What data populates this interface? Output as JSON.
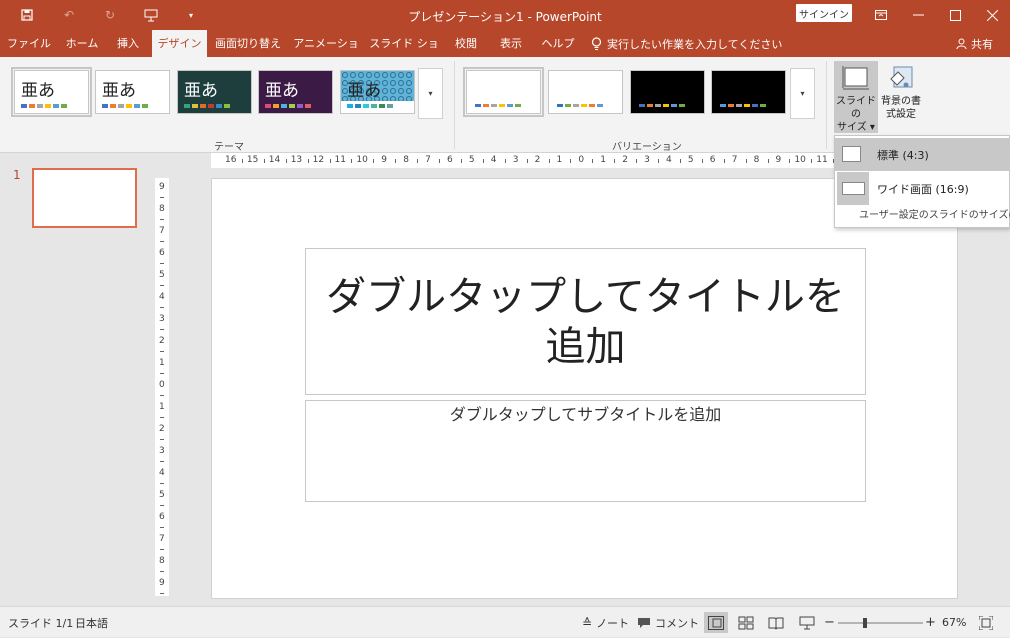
{
  "titlebar": {
    "doc_title": "プレゼンテーション1  -  PowerPoint",
    "signin_label": "サインイン",
    "icons": [
      "save-icon",
      "undo-icon",
      "redo-icon",
      "start-from-beginning-icon",
      "customize-qat-icon",
      "ribbon-display-options-icon",
      "minimize-icon",
      "maximize-icon",
      "close-icon"
    ]
  },
  "tabs": [
    "ファイル",
    "ホーム",
    "挿入",
    "デザイン",
    "画面切り替え",
    "アニメーション",
    "スライド ショー",
    "校閲",
    "表示",
    "ヘルプ"
  ],
  "active_tab": "デザイン",
  "tell_me": "実行したい作業を入力してください",
  "share_label": "共有",
  "ribbon": {
    "themes_group_label": "テーマ",
    "variations_group_label": "バリエーション",
    "theme_sample_text": "亜あ",
    "slide_size_label_1": "スライドの",
    "slide_size_label_2": "サイズ",
    "bg_format_label_1": "背景の書",
    "bg_format_label_2": "式設定",
    "accent_color": "#b7472a"
  },
  "slide_size_menu": {
    "standard": "標準 (4:3)",
    "widescreen": "ワイド画面 (16:9)",
    "custom": "ユーザー設定のスライドのサイズ(C)..."
  },
  "thumbnails": {
    "slide_number": "1"
  },
  "ruler": {
    "horizontal": [
      "16",
      "15",
      "14",
      "13",
      "12",
      "11",
      "10",
      "9",
      "8",
      "7",
      "6",
      "5",
      "4",
      "3",
      "2",
      "1",
      "0",
      "1",
      "2",
      "3",
      "4",
      "5",
      "6",
      "7",
      "8",
      "9",
      "10",
      "11"
    ],
    "vertical": [
      "9",
      "8",
      "7",
      "6",
      "5",
      "4",
      "3",
      "2",
      "1",
      "0",
      "1",
      "2",
      "3",
      "4",
      "5",
      "6",
      "7",
      "8",
      "9"
    ]
  },
  "slide": {
    "title_placeholder": "ダブルタップしてタイトルを追加",
    "subtitle_placeholder": "ダブルタップしてサブタイトルを追加"
  },
  "statusbar": {
    "slide_info": "スライド 1/1",
    "language": "日本語",
    "notes_label": "ノート",
    "comments_label": "コメント",
    "zoom_minus": "−",
    "zoom_plus": "+",
    "zoom_level": "67%"
  }
}
